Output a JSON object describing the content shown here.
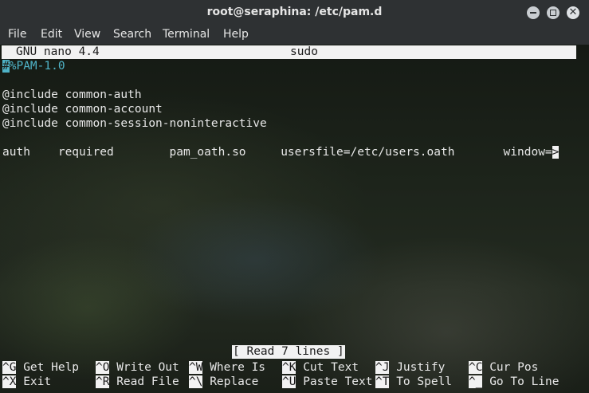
{
  "window": {
    "title": "root@seraphina: /etc/pam.d",
    "buttons": {
      "minimize": "–",
      "maximize": "□",
      "close": "✕"
    }
  },
  "menu": [
    "File",
    "Edit",
    "View",
    "Search",
    "Terminal",
    "Help"
  ],
  "nano": {
    "version": "GNU nano 4.4",
    "filename": "sudo"
  },
  "editor": {
    "line1_hash": "#",
    "line1_rest": "%PAM-1.0",
    "line3": "@include common-auth",
    "line4": "@include common-account",
    "line5": "@include common-session-noninteractive",
    "line7": "auth    required        pam_oath.so     usersfile=/etc/users.oath       window=",
    "overflow": ">"
  },
  "status": "[ Read 7 lines ]",
  "shortcuts": {
    "row1": [
      {
        "key": "^G",
        "label": "Get Help"
      },
      {
        "key": "^O",
        "label": "Write Out"
      },
      {
        "key": "^W",
        "label": "Where Is"
      },
      {
        "key": "^K",
        "label": "Cut Text"
      },
      {
        "key": "^J",
        "label": "Justify"
      },
      {
        "key": "^C",
        "label": "Cur Pos"
      }
    ],
    "row2": [
      {
        "key": "^X",
        "label": "Exit"
      },
      {
        "key": "^R",
        "label": "Read File"
      },
      {
        "key": "^\\",
        "label": "Replace"
      },
      {
        "key": "^U",
        "label": "Paste Text"
      },
      {
        "key": "^T",
        "label": "To Spell"
      },
      {
        "key": "^_",
        "label": "Go To Line"
      }
    ]
  },
  "colors": {
    "titlebar": "#2e3133",
    "comment": "#4fb3c7",
    "inverse_bg": "#f2f2f2"
  }
}
